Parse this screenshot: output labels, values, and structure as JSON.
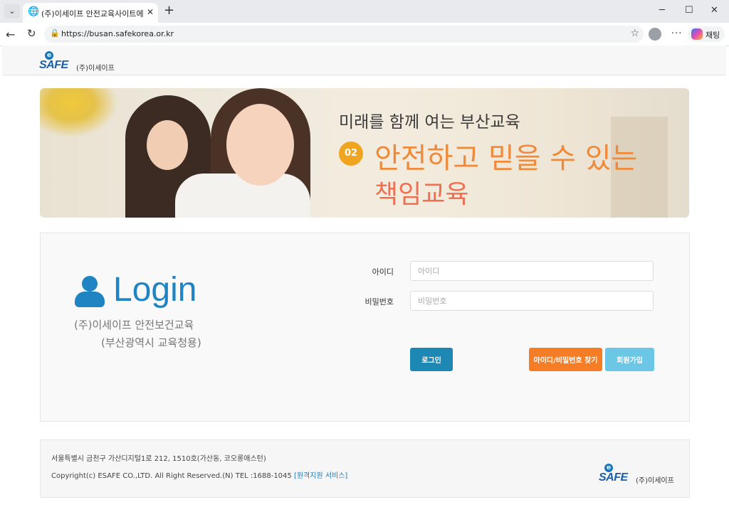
{
  "browser": {
    "tab_title": "(주)이세이프 안전교육사이트에 오",
    "url": "https://busan.safekorea.or.kr",
    "copilot_label": "채팅"
  },
  "header": {
    "logo_safe": "SAFE",
    "logo_company": "(주)이세이프"
  },
  "banner": {
    "line1": "미래를 함께 여는 부산교육",
    "badge": "02",
    "line2": "안전하고 믿을 수 있는",
    "line3": "책임교육"
  },
  "login": {
    "heading": "Login",
    "subtitle1": "(주)이세이프 안전보건교육",
    "subtitle2": "(부산광역시 교육청용)",
    "id_label": "아이디",
    "id_placeholder": "아이디",
    "pw_label": "비밀번호",
    "pw_placeholder": "비밀번호",
    "login_button": "로그인",
    "find_button": "아이디/비밀번호 찾기",
    "join_button": "회원가입"
  },
  "footer": {
    "address": "서울특별시 금천구 가산디지털1로 212, 1510호(가산동, 코오롱애스턴)",
    "copyright": "Copyright(c) ESAFE CO.,LTD. All Right Reserved.(N) TEL :1688-1045 ",
    "remote_link": "[원격지원 서비스]"
  },
  "colors": {
    "accent_blue": "#2084c2",
    "login_button": "#1e88b5",
    "find_button": "#f47d26",
    "join_button": "#6cc6e6"
  }
}
